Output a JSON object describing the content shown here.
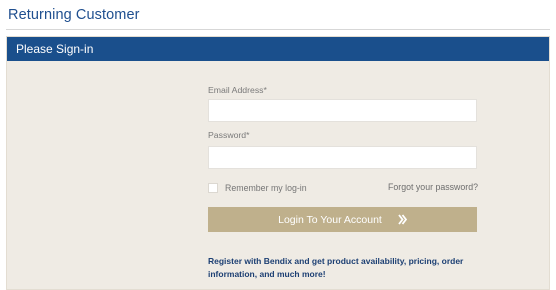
{
  "section": {
    "title": "Returning Customer"
  },
  "panel": {
    "header": "Please Sign-in"
  },
  "form": {
    "email_label": "Email Address*",
    "email_value": "",
    "password_label": "Password*",
    "password_value": "",
    "remember_label": "Remember my log-in",
    "remember_checked": false,
    "forgot_link": "Forgot your password?",
    "login_button": "Login To Your Account",
    "login_icon": "double-chevron-right-icon",
    "register_text": "Register with Bendix and get product availability, pricing, order information, and much more!"
  },
  "colors": {
    "title": "#1f4f8f",
    "header_bg": "#1a4f8c",
    "panel_bg": "#efebe4",
    "button_bg": "#bfb08c",
    "register_text": "#1c3f73"
  }
}
